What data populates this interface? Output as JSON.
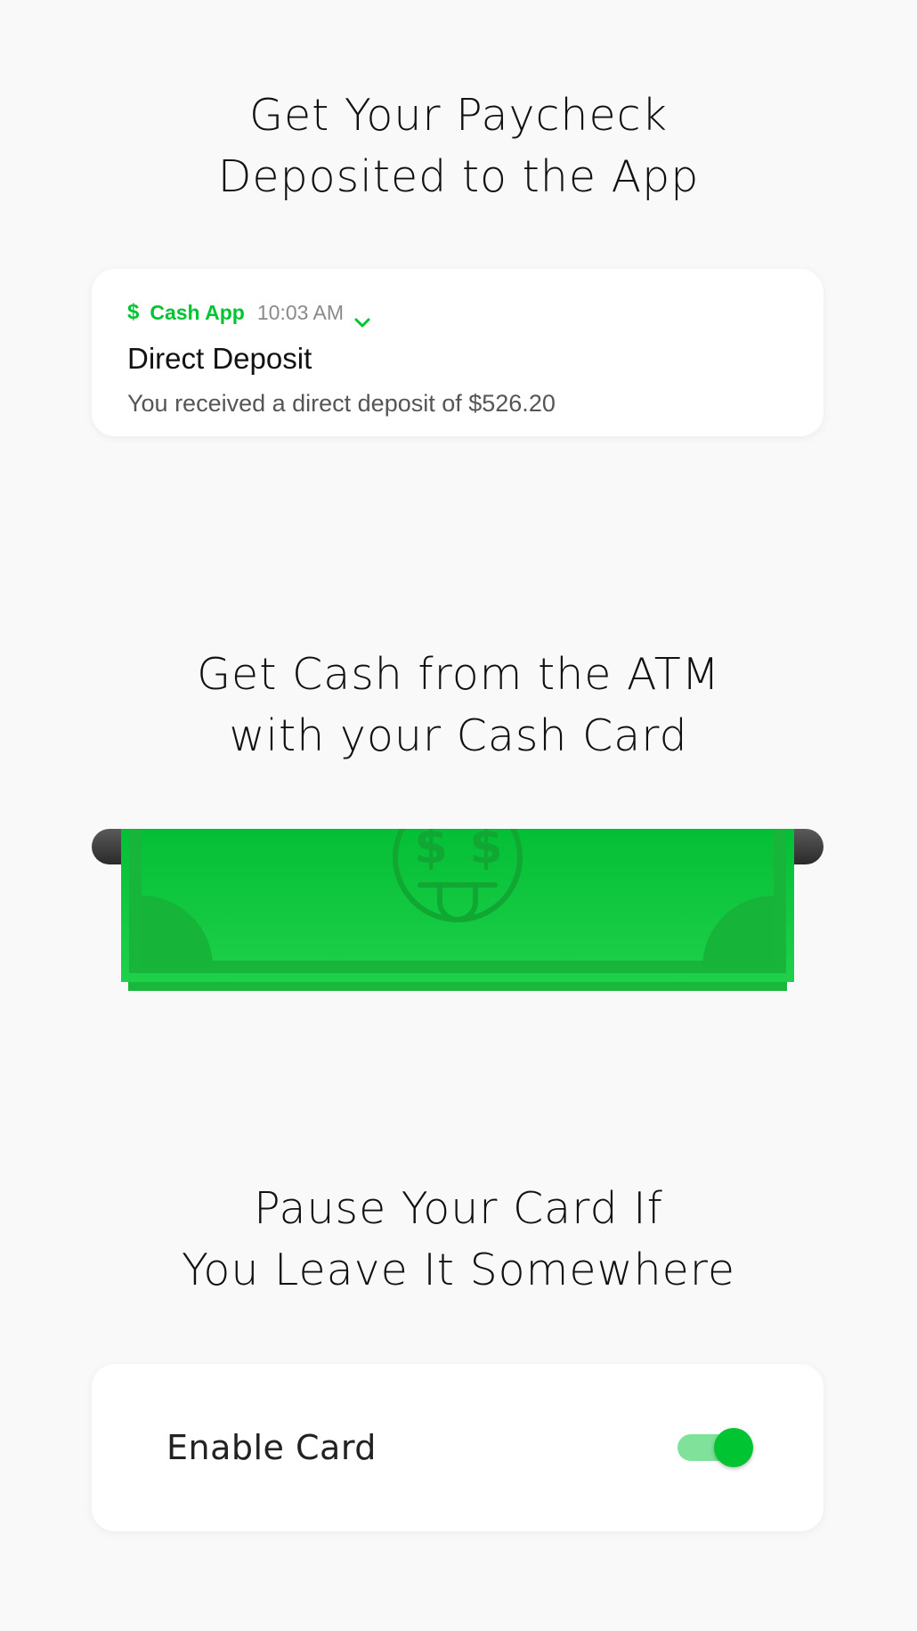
{
  "sections": {
    "paycheck": {
      "heading_line1": "Get Your Paycheck",
      "heading_line2": "Deposited to the App"
    },
    "atm": {
      "heading_line1": "Get Cash from the ATM",
      "heading_line2": "with your Cash Card"
    },
    "pause": {
      "heading_line1": "Pause Your Card If",
      "heading_line2": "You Leave It Somewhere"
    }
  },
  "notification": {
    "app_icon": "dollar-icon",
    "app_name": "Cash App",
    "time": "10:03 AM",
    "title": "Direct Deposit",
    "body": "You received a direct deposit of $526.20"
  },
  "card_toggle": {
    "label": "Enable Card",
    "enabled": true
  },
  "colors": {
    "accent": "#00c431",
    "background": "#f9f9f9",
    "toggle_track": "#7fe19a"
  }
}
